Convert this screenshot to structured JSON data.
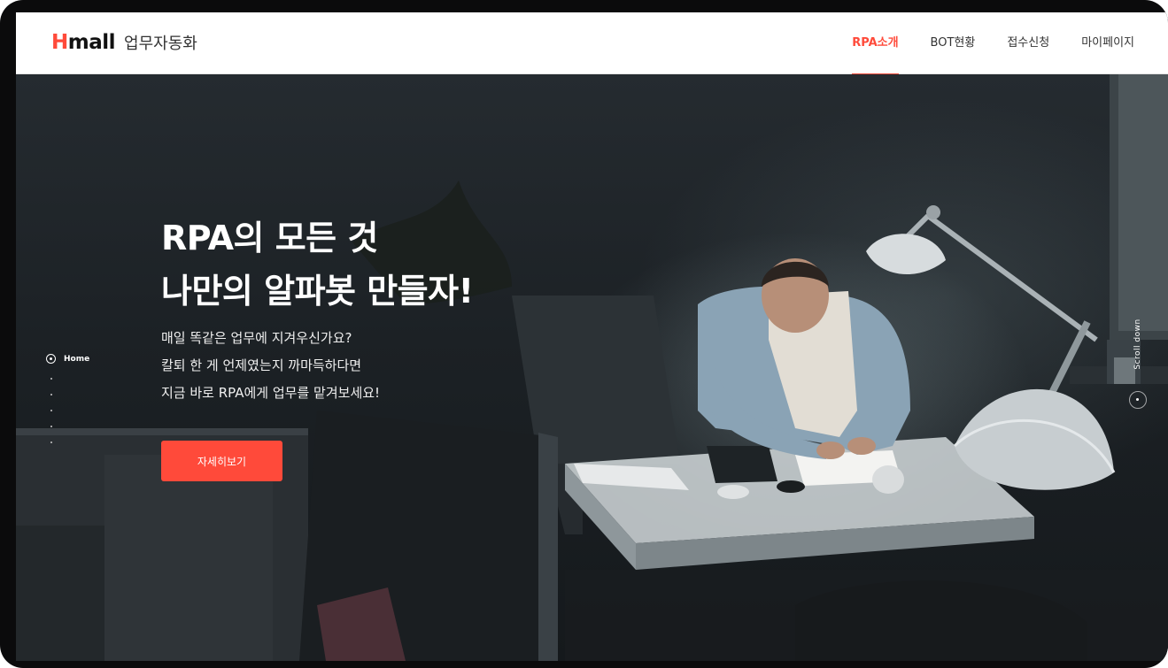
{
  "header": {
    "logo_mark_h": "H",
    "logo_mark_rest": "mall",
    "logo_sub": "업무자동화",
    "nav": [
      {
        "label": "RPA소개",
        "active": true
      },
      {
        "label": "BOT현황",
        "active": false
      },
      {
        "label": "접수신청",
        "active": false
      },
      {
        "label": "마이페이지",
        "active": false
      }
    ]
  },
  "hero": {
    "title_line1": "RPA의 모든 것",
    "title_line2": "나만의 알파봇 만들자!",
    "desc_line1": "매일 똑같은 업무에 지겨우신가요?",
    "desc_line2": "칼퇴 한 게 언제였는지 까마득하다면",
    "desc_line3": "지금 바로 RPA에게 업무를 맡겨보세요!",
    "cta_label": "자세히보기"
  },
  "side_nav": {
    "home_label": "Home",
    "dot_count": 5
  },
  "scroll": {
    "label": "Scroll down"
  },
  "colors": {
    "accent": "#ff4a3a",
    "header_bg": "#ffffff",
    "hero_bg": "#1d2226"
  }
}
